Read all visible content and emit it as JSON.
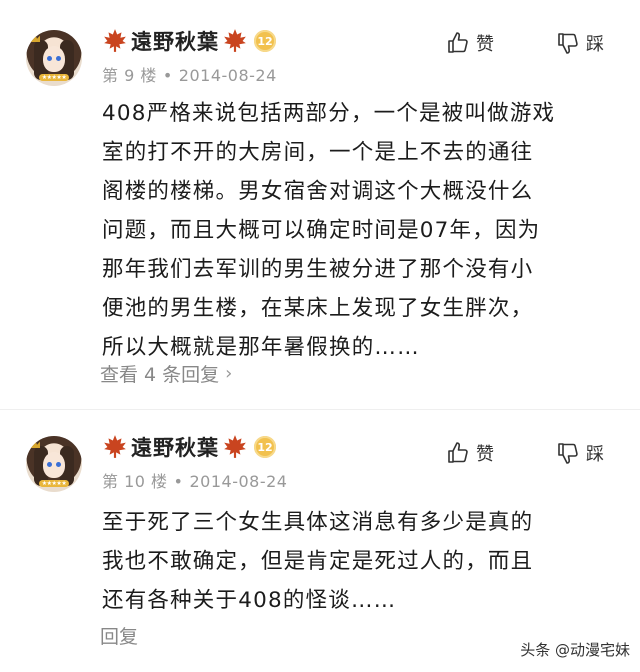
{
  "posts": [
    {
      "username": "遠野秋葉",
      "level": "12",
      "floor": "第 9 楼",
      "date": "2014-08-24",
      "like_label": "赞",
      "dislike_label": "踩",
      "lines": [
        "408严格来说包括两部分，一个是被叫做游戏",
        "室的打不开的大房间，一个是上不去的通往",
        "阁楼的楼梯。男女宿舍对调这个大概没什么",
        "问题，而且大概可以确定时间是07年，因为",
        "那年我们去军训的男生被分进了那个没有小",
        "便池的男生楼，在某床上发现了女生胖次，",
        "所以大概就是那年暑假换的……"
      ],
      "reply_link": "查看 4 条回复"
    },
    {
      "username": "遠野秋葉",
      "level": "12",
      "floor": "第 10 楼",
      "date": "2014-08-24",
      "like_label": "赞",
      "dislike_label": "踩",
      "lines": [
        "至于死了三个女生具体这消息有多少是真的",
        "我也不敢确定，但是肯定是死过人的，而且",
        "还有各种关于408的怪谈……"
      ],
      "reply_link": "回复"
    }
  ],
  "meta_separator": "•",
  "watermark": "头条 @动漫宅妹",
  "colors": {
    "leaf": "#c9441f",
    "level_badge": "#f2c14e",
    "meta_text": "#999999"
  },
  "icons": {
    "leaf": "maple-leaf-icon",
    "like": "thumbs-up-icon",
    "dislike": "thumbs-down-icon",
    "chevron": "chevron-right-icon"
  }
}
